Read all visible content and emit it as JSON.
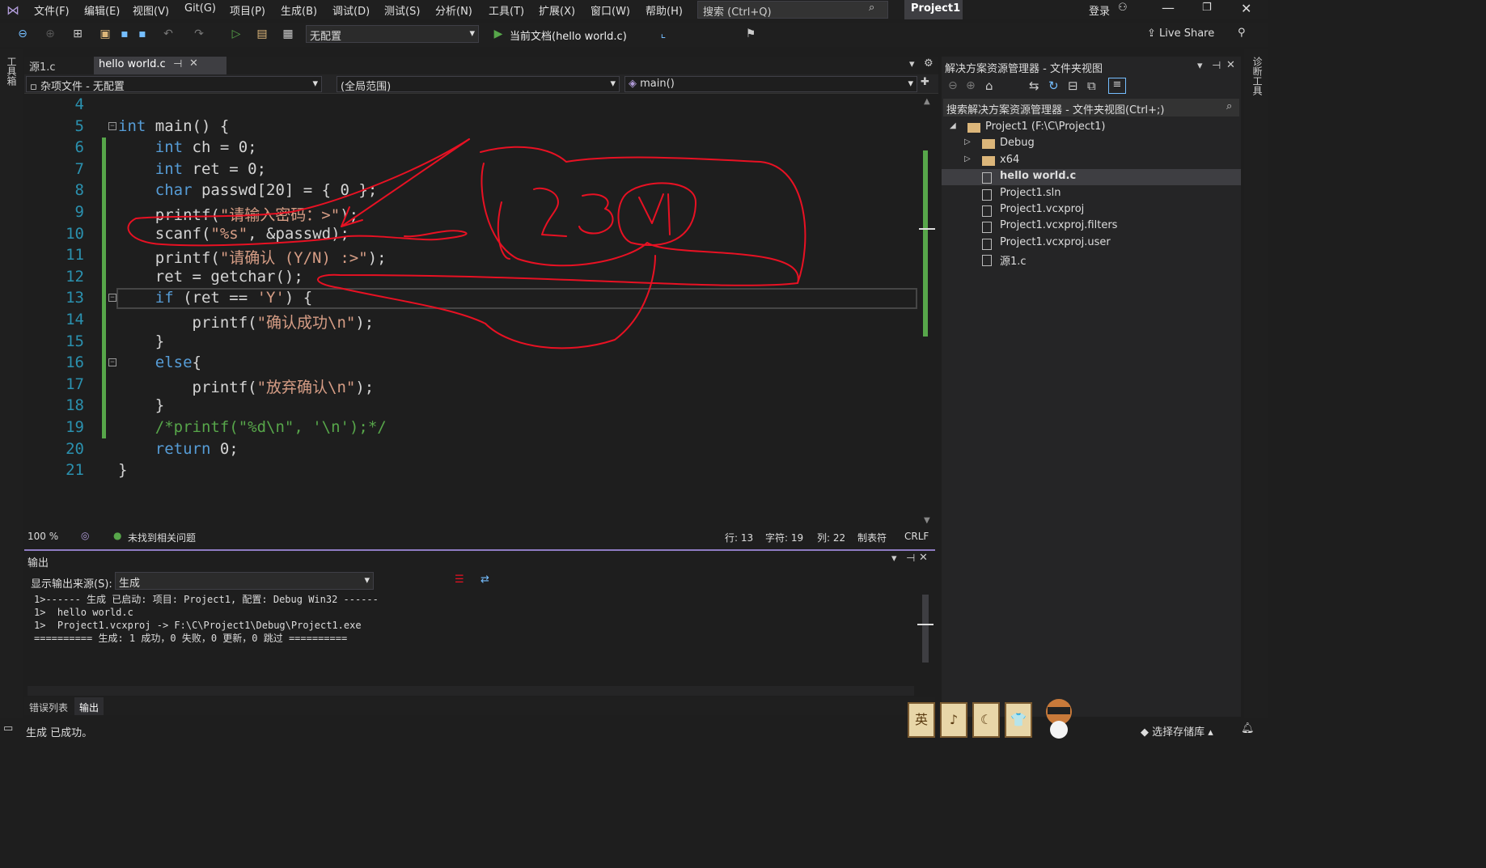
{
  "menu": {
    "items": [
      "文件(F)",
      "编辑(E)",
      "视图(V)",
      "Git(G)",
      "项目(P)",
      "生成(B)",
      "调试(D)",
      "测试(S)",
      "分析(N)",
      "工具(T)",
      "扩展(X)",
      "窗口(W)",
      "帮助(H)"
    ],
    "search_placeholder": "搜索 (Ctrl+Q)",
    "project_title": "Project1",
    "login": "登录"
  },
  "toolbar": {
    "config": "无配置",
    "run_target": "当前文档(hello world.c)",
    "live_share": "Live Share"
  },
  "left_strip": {
    "label": "工具箱"
  },
  "right_strip": {
    "label": "诊断工具"
  },
  "editor": {
    "tabs": [
      "源1.c",
      "hello world.c"
    ],
    "nav": {
      "project": "杂项文件 - 无配置",
      "scope": "(全局范围)",
      "member": "main()"
    },
    "lines": [
      {
        "num": "4",
        "tokens": []
      },
      {
        "num": "5",
        "tokens": [
          {
            "t": "int",
            "c": "kw"
          },
          {
            "t": " main() {",
            "c": ""
          }
        ]
      },
      {
        "num": "6",
        "tokens": [
          {
            "t": "    int",
            "c": "kw"
          },
          {
            "t": " ch = 0;",
            "c": ""
          }
        ]
      },
      {
        "num": "7",
        "tokens": [
          {
            "t": "    int",
            "c": "kw"
          },
          {
            "t": " ret = 0;",
            "c": ""
          }
        ]
      },
      {
        "num": "8",
        "tokens": [
          {
            "t": "    char",
            "c": "kw"
          },
          {
            "t": " passwd[20] = { 0 };",
            "c": ""
          }
        ]
      },
      {
        "num": "9",
        "tokens": [
          {
            "t": "    printf(",
            "c": ""
          },
          {
            "t": "\"请输入密码：>\"",
            "c": "str"
          },
          {
            "t": ");",
            "c": ""
          }
        ]
      },
      {
        "num": "10",
        "tokens": [
          {
            "t": "    scanf(",
            "c": ""
          },
          {
            "t": "\"%s\"",
            "c": "str"
          },
          {
            "t": ", &passwd);",
            "c": ""
          }
        ]
      },
      {
        "num": "11",
        "tokens": [
          {
            "t": "    printf(",
            "c": ""
          },
          {
            "t": "\"请确认 (Y/N) :>\"",
            "c": "str"
          },
          {
            "t": ");",
            "c": ""
          }
        ]
      },
      {
        "num": "12",
        "tokens": [
          {
            "t": "    ret = getchar();",
            "c": ""
          }
        ]
      },
      {
        "num": "13",
        "tokens": [
          {
            "t": "    if",
            "c": "kw"
          },
          {
            "t": " (ret == ",
            "c": ""
          },
          {
            "t": "'Y'",
            "c": "str"
          },
          {
            "t": ") {",
            "c": ""
          }
        ]
      },
      {
        "num": "14",
        "tokens": [
          {
            "t": "        printf(",
            "c": ""
          },
          {
            "t": "\"确认成功\\n\"",
            "c": "str"
          },
          {
            "t": ");",
            "c": ""
          }
        ]
      },
      {
        "num": "15",
        "tokens": [
          {
            "t": "    }",
            "c": ""
          }
        ]
      },
      {
        "num": "16",
        "tokens": [
          {
            "t": "    else",
            "c": "kw"
          },
          {
            "t": "{",
            "c": ""
          }
        ]
      },
      {
        "num": "17",
        "tokens": [
          {
            "t": "        printf(",
            "c": ""
          },
          {
            "t": "\"放弃确认\\n\"",
            "c": "str"
          },
          {
            "t": ");",
            "c": ""
          }
        ]
      },
      {
        "num": "18",
        "tokens": [
          {
            "t": "    }",
            "c": ""
          }
        ]
      },
      {
        "num": "19",
        "tokens": [
          {
            "t": "    /*printf(\"%d\\n\", '\\n');*/",
            "c": "cm"
          }
        ]
      },
      {
        "num": "20",
        "tokens": [
          {
            "t": "    return",
            "c": "kw"
          },
          {
            "t": " 0;",
            "c": ""
          }
        ]
      },
      {
        "num": "21",
        "tokens": [
          {
            "t": "}",
            "c": ""
          }
        ]
      }
    ],
    "status": {
      "zoom": "100 %",
      "issues": "未找到相关问题",
      "row": "行: 13",
      "char": "字符: 19",
      "col": "列: 22",
      "tabs": "制表符",
      "eol": "CRLF"
    }
  },
  "output": {
    "title": "输出",
    "source_label": "显示输出来源(S):",
    "source_value": "生成",
    "text": "1>------ 生成 已启动: 项目: Project1, 配置: Debug Win32 ------\n1>  hello world.c\n1>  Project1.vcxproj -> F:\\C\\Project1\\Debug\\Project1.exe\n========== 生成: 1 成功，0 失败，0 更新，0 跳过 =========="
  },
  "bottom_tabs": [
    "错误列表",
    "输出"
  ],
  "solution_explorer": {
    "title": "解决方案资源管理器 - 文件夹视图",
    "search_placeholder": "搜索解决方案资源管理器 - 文件夹视图(Ctrl+;)",
    "tree": [
      {
        "label": "Project1 (F:\\C\\Project1)",
        "type": "folder",
        "depth": 0,
        "arrow": "◢"
      },
      {
        "label": "Debug",
        "type": "folder",
        "depth": 1,
        "arrow": "▷"
      },
      {
        "label": "x64",
        "type": "folder",
        "depth": 1,
        "arrow": "▷"
      },
      {
        "label": "hello world.c",
        "type": "file",
        "depth": 1,
        "arrow": "",
        "selected": true
      },
      {
        "label": "Project1.sln",
        "type": "file",
        "depth": 1,
        "arrow": ""
      },
      {
        "label": "Project1.vcxproj",
        "type": "file",
        "depth": 1,
        "arrow": ""
      },
      {
        "label": "Project1.vcxproj.filters",
        "type": "file",
        "depth": 1,
        "arrow": ""
      },
      {
        "label": "Project1.vcxproj.user",
        "type": "file",
        "depth": 1,
        "arrow": ""
      },
      {
        "label": "源1.c",
        "type": "file",
        "depth": 1,
        "arrow": ""
      }
    ]
  },
  "statusbar": {
    "message": "生成 已成功。",
    "repo": "选择存储库",
    "badges": [
      "英",
      "♪",
      "☾",
      "👕"
    ]
  },
  "colors": {
    "accent": "#8e7cc3",
    "annotation": "#e81123",
    "green_margin": "#57a64a"
  }
}
